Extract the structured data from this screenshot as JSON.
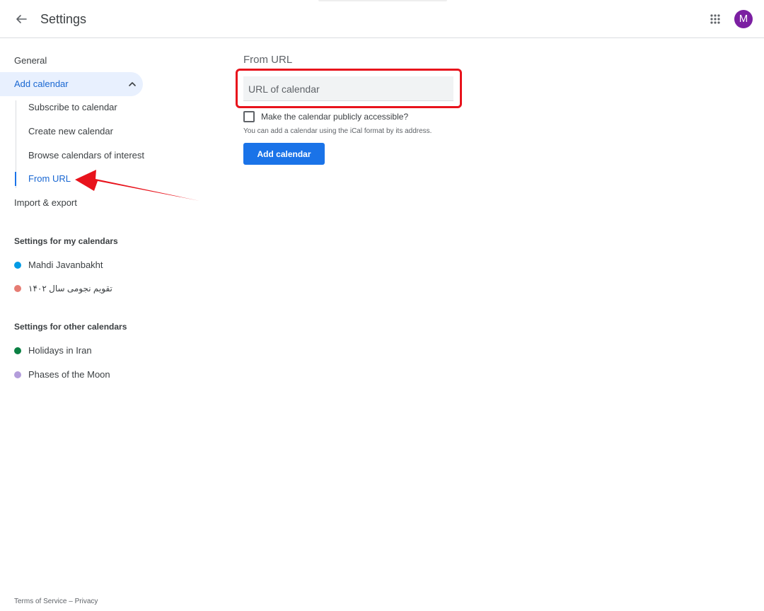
{
  "header": {
    "title": "Settings",
    "avatar_initial": "M",
    "back_icon": "arrow-left-icon",
    "apps_icon": "apps-grid-icon"
  },
  "sidebar": {
    "general": "General",
    "add_calendar": {
      "label": "Add calendar",
      "expanded": true,
      "items": [
        "Subscribe to calendar",
        "Create new calendar",
        "Browse calendars of interest",
        "From URL"
      ],
      "active_item": "From URL"
    },
    "import_export": "Import & export",
    "my_calendars": {
      "heading": "Settings for my calendars",
      "items": [
        {
          "label": "Mahdi Javanbakht",
          "color": "#039be5"
        },
        {
          "label": "تقویم نجومی سال ۱۴۰۲",
          "color": "#e67c73"
        }
      ]
    },
    "other_calendars": {
      "heading": "Settings for other calendars",
      "items": [
        {
          "label": "Holidays in Iran",
          "color": "#0b8043"
        },
        {
          "label": "Phases of the Moon",
          "color": "#b39ddb"
        }
      ]
    }
  },
  "main": {
    "title": "From URL",
    "url_placeholder": "URL of calendar",
    "url_value": "",
    "checkbox_label": "Make the calendar publicly accessible?",
    "checkbox_checked": false,
    "help_text": "You can add a calendar using the iCal format by its address.",
    "add_button": "Add calendar"
  },
  "footer": {
    "terms": "Terms of Service",
    "separator": " – ",
    "privacy": "Privacy"
  },
  "colors": {
    "accent": "#1a73e8",
    "active_text": "#1967d2",
    "active_bg": "#e8f0fe",
    "annotation": "#e8131c",
    "avatar": "#7b1fa2"
  }
}
